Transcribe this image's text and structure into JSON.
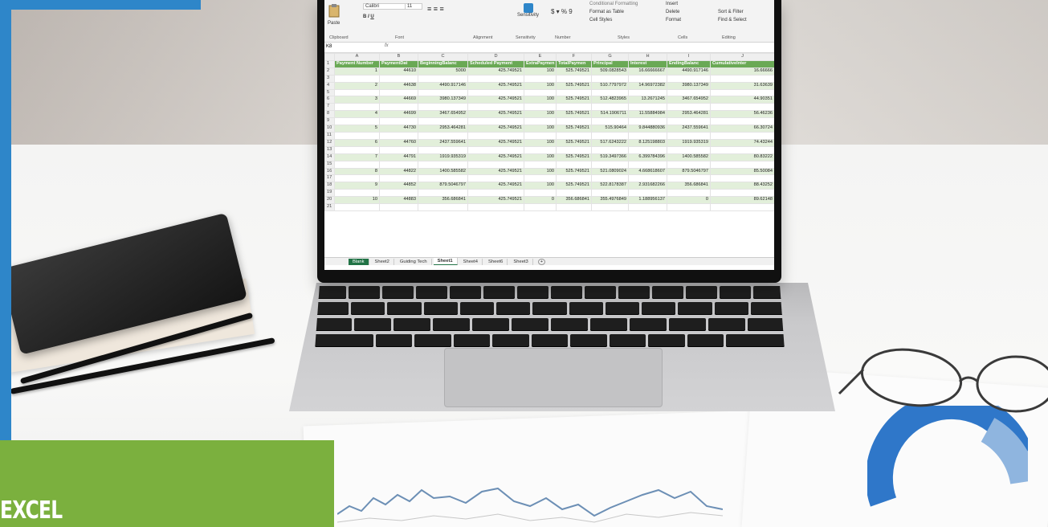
{
  "banner": {
    "text": "EXCEL"
  },
  "colors": {
    "banner": "#7bb03e",
    "stripe": "#2e86c9",
    "table_header": "#6aa955",
    "table_band": "#e2efda",
    "sheet_tab_green": "#217346"
  },
  "excel": {
    "ribbon": {
      "font_name": "Calibri",
      "font_size": "11",
      "paste_label": "Paste",
      "sensitivity_label": "Sensitivity",
      "format_as_table": "Format as Table",
      "cell_styles": "Cell Styles",
      "conditional_formatting": "Conditional Formatting",
      "insert": "Insert",
      "delete": "Delete",
      "format": "Format",
      "sort_filter": "Sort & Filter",
      "find_select": "Find & Select",
      "groups": [
        "Clipboard",
        "Font",
        "Alignment",
        "Sensitivity",
        "Number",
        "Styles",
        "Cells",
        "Editing"
      ]
    },
    "name_box": "K8",
    "columns": [
      "A",
      "B",
      "C",
      "D",
      "E",
      "F",
      "G",
      "H",
      "I",
      "J"
    ],
    "headers": [
      "Payment Number",
      "PaymentDat",
      "BeginningBalanc",
      "Scheduled Payment",
      "ExtraPaymen",
      "TotalPaymen",
      "Principal",
      "Interest",
      "EndingBalanc",
      "CumulativeInter"
    ],
    "rows": [
      [
        "1",
        "44610",
        "5000",
        "425.749521",
        "100",
        "525.749521",
        "509.0828543",
        "16.66666667",
        "4490.917146",
        "16.66666"
      ],
      [
        "2",
        "44638",
        "4490.917146",
        "425.749521",
        "100",
        "525.749521",
        "510.7797972",
        "14.96972382",
        "3980.137349",
        "31.63639"
      ],
      [
        "3",
        "44669",
        "3980.137349",
        "425.749521",
        "100",
        "525.749521",
        "512.4823965",
        "13.2671245",
        "3467.654952",
        "44.90351"
      ],
      [
        "4",
        "44699",
        "3467.654952",
        "425.749521",
        "100",
        "525.749521",
        "514.1906711",
        "11.55884984",
        "2953.464281",
        "56.46236"
      ],
      [
        "5",
        "44730",
        "2953.464281",
        "425.749521",
        "100",
        "525.749521",
        "515.90464",
        "9.844880936",
        "2437.559641",
        "66.30724"
      ],
      [
        "6",
        "44760",
        "2437.559641",
        "425.749521",
        "100",
        "525.749521",
        "517.6243222",
        "8.125198803",
        "1919.935319",
        "74.43244"
      ],
      [
        "7",
        "44791",
        "1919.935319",
        "425.749521",
        "100",
        "525.749521",
        "519.3497366",
        "6.399784396",
        "1400.585582",
        "80.83222"
      ],
      [
        "8",
        "44822",
        "1400.585582",
        "425.749521",
        "100",
        "525.749521",
        "521.0809024",
        "4.668618607",
        "879.5046797",
        "85.50084"
      ],
      [
        "9",
        "44852",
        "879.5046797",
        "425.749521",
        "100",
        "525.749521",
        "522.8178387",
        "2.931682266",
        "356.686841",
        "88.43252"
      ],
      [
        "10",
        "44883",
        "356.686841",
        "425.749521",
        "0",
        "356.686841",
        "355.4976849",
        "1.188956137",
        "0",
        "89.62148"
      ]
    ],
    "sheet_tabs": [
      "Blank",
      "Sheet2",
      "Guiding Tech",
      "Sheet1",
      "Sheet4",
      "Sheet6",
      "Sheet3"
    ],
    "active_tab": "Sheet1"
  }
}
